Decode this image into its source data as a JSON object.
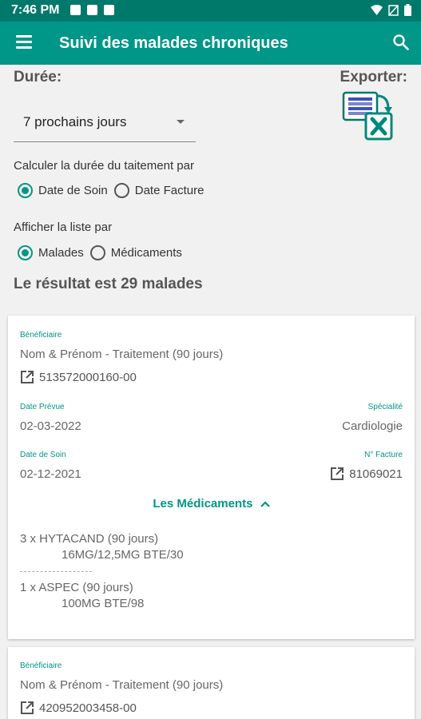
{
  "status": {
    "time": "7:46 PM"
  },
  "app": {
    "title": "Suivi des malades chroniques"
  },
  "filters": {
    "duration_label": "Durée:",
    "export_label": "Exporter:",
    "duration_value": "7 prochains jours",
    "calc_label": "Calculer la durée du taitement par",
    "calc_options": [
      "Date de Soin",
      "Date Facture"
    ],
    "calc_selected": "Date de Soin",
    "list_label": "Afficher la liste par",
    "list_options": [
      "Malades",
      "Médicaments"
    ],
    "list_selected": "Malades"
  },
  "result_text": "Le résultat est 29 malades",
  "cards": [
    {
      "beneficiaire_label": "Bénéficiaire",
      "name": "Nom & Prénom - Traitement (90 jours)",
      "id": "513572000160-00",
      "date_prevue_label": "Date Prévue",
      "date_prevue": "02-03-2022",
      "specialite_label": "Spécialité",
      "specialite": "Cardiologie",
      "date_soin_label": "Date de Soin",
      "date_soin": "02-12-2021",
      "facture_label": "N° Facture",
      "facture": "81069021",
      "toggle_label": "Les Médicaments",
      "meds": [
        {
          "line1": "3 x HYTACAND (90 jours)",
          "line2": "16MG/12,5MG BTE/30"
        },
        {
          "line1": "1 x ASPEC (90 jours)",
          "line2": "100MG BTE/98"
        }
      ]
    },
    {
      "beneficiaire_label": "Bénéficiaire",
      "name": "Nom & Prénom - Traitement (90 jours)",
      "id": "420952003458-00"
    }
  ]
}
